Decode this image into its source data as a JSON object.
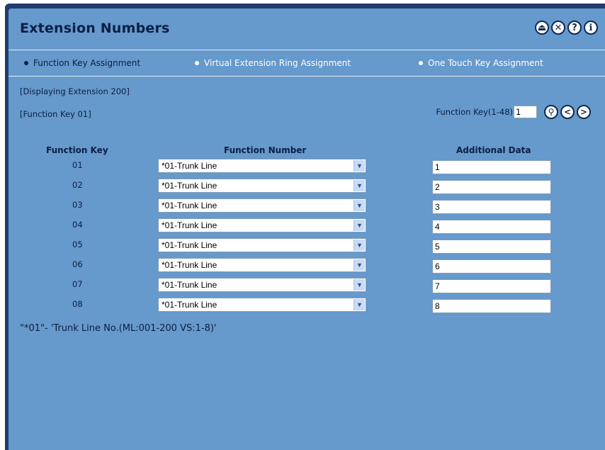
{
  "header": {
    "title": "Extension Numbers",
    "icons": [
      "logout-icon",
      "close-icon",
      "help-icon",
      "info-icon"
    ]
  },
  "tabs": [
    {
      "label": "Function Key Assignment",
      "active": true
    },
    {
      "label": "Virtual Extension Ring Assignment",
      "active": false
    },
    {
      "label": "One Touch Key Assignment",
      "active": false
    }
  ],
  "info": {
    "displaying": "[Displaying Extension 200]",
    "function_key": "[Function Key 01]"
  },
  "nav": {
    "label": "Function Key(1-48)",
    "value": "1"
  },
  "table": {
    "headers": {
      "key": "Function Key",
      "number": "Function Number",
      "data": "Additional Data"
    },
    "rows": [
      {
        "key": "01",
        "number": "*01-Trunk Line",
        "data": "1"
      },
      {
        "key": "02",
        "number": "*01-Trunk Line",
        "data": "2"
      },
      {
        "key": "03",
        "number": "*01-Trunk Line",
        "data": "3"
      },
      {
        "key": "04",
        "number": "*01-Trunk Line",
        "data": "4"
      },
      {
        "key": "05",
        "number": "*01-Trunk Line",
        "data": "5"
      },
      {
        "key": "06",
        "number": "*01-Trunk Line",
        "data": "6"
      },
      {
        "key": "07",
        "number": "*01-Trunk Line",
        "data": "7"
      },
      {
        "key": "08",
        "number": "*01-Trunk Line",
        "data": "8"
      }
    ]
  },
  "note": "\"*01\"-  'Trunk Line No.(ML:001-200 VS:1-8)'",
  "colors": {
    "panel": "#6699cc",
    "frame": "#1f3d6e",
    "text_dark": "#0b1f44"
  }
}
